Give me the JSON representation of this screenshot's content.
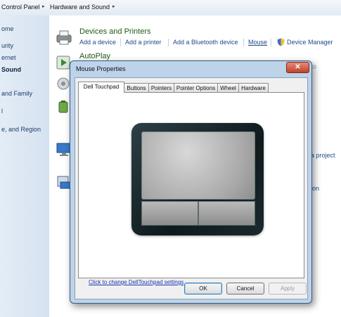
{
  "breadcrumb": {
    "items": [
      "Control Panel",
      "Hardware and Sound"
    ],
    "separator": "▸"
  },
  "left_nav": {
    "items": [
      {
        "label": "ome",
        "bold": false
      },
      {
        "label": "urity",
        "bold": false
      },
      {
        "label": "ernet",
        "bold": false
      },
      {
        "label": "Sound",
        "bold": true
      },
      {
        "label": "and Family",
        "bold": false
      },
      {
        "label": "l",
        "bold": false
      },
      {
        "label": "e, and Region",
        "bold": false
      }
    ]
  },
  "devices_printers": {
    "title": "Devices and Printers",
    "links": [
      "Add a device",
      "Add a printer",
      "Add a Bluetooth device",
      "Mouse",
      "Device Manager"
    ]
  },
  "autoplay": {
    "title": "AutoPlay"
  },
  "right_fragments": {
    "projector": "a project",
    "ion": "ion"
  },
  "dialog": {
    "title": "Mouse Properties",
    "close_symbol": "✕",
    "tabs": [
      "Dell Touchpad",
      "Buttons",
      "Pointers",
      "Pointer Options",
      "Wheel",
      "Hardware"
    ],
    "active_tab": "Dell Touchpad",
    "settings_link": "Click to change DellTouchpad settings",
    "buttons": {
      "ok": "OK",
      "cancel": "Cancel",
      "apply": "Apply"
    }
  },
  "colors": {
    "accent_link": "#1d4a8a",
    "category_title": "#1e5a12",
    "close_red": "#c4412a"
  }
}
